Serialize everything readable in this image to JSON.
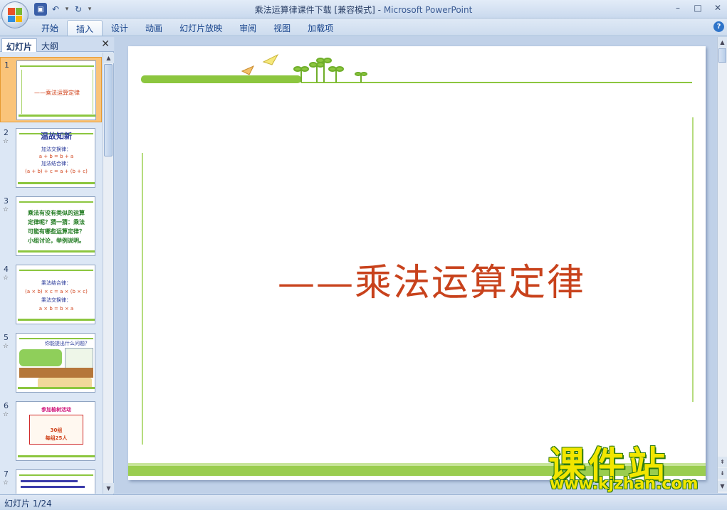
{
  "window": {
    "title_doc": "乘法运算律课件下载 [兼容模式] - ",
    "title_app": "Microsoft PowerPoint"
  },
  "ribbon": {
    "tabs": [
      {
        "label": "开始"
      },
      {
        "label": "插入"
      },
      {
        "label": "设计"
      },
      {
        "label": "动画"
      },
      {
        "label": "幻灯片放映"
      },
      {
        "label": "审阅"
      },
      {
        "label": "视图"
      },
      {
        "label": "加载项"
      }
    ],
    "active_tab": "插入"
  },
  "pane": {
    "tab_slides": "幻灯片",
    "tab_outline": "大纲",
    "thumbnails": [
      {
        "num": "1",
        "line1": "——乘法运算定律"
      },
      {
        "num": "2",
        "line1": "温故知新",
        "line2": "加法交换律：",
        "line3": "a + b = b + a",
        "line4": "加法结合律：",
        "line5": "(a + b) + c = a + (b + c)"
      },
      {
        "num": "3",
        "line1": "乘法有没有类似的运算",
        "line2": "定律呢？猜一猜：乘法",
        "line3": "可能有哪些运算定律？",
        "line4": "小组讨论，举例说明。"
      },
      {
        "num": "4",
        "line1": "乘法结合律：",
        "line2": "(a × b) × c = a × (b × c)",
        "line3": "乘法交换律：",
        "line4": "a × b = b × a"
      },
      {
        "num": "5",
        "line1": "你能提出什么问题？"
      },
      {
        "num": "6",
        "line1": "参加植树活动",
        "line2": "30组",
        "line3": "每组25人"
      },
      {
        "num": "7",
        "line1": ""
      }
    ]
  },
  "slide": {
    "title": "——乘法运算定律"
  },
  "watermark": {
    "brand": "课件站",
    "url": "www.kjzhan.com"
  },
  "status": {
    "slide_counter": "幻灯片 1/24"
  },
  "colors": {
    "accent_green": "#8cc63f",
    "title_red": "#c8421c"
  }
}
